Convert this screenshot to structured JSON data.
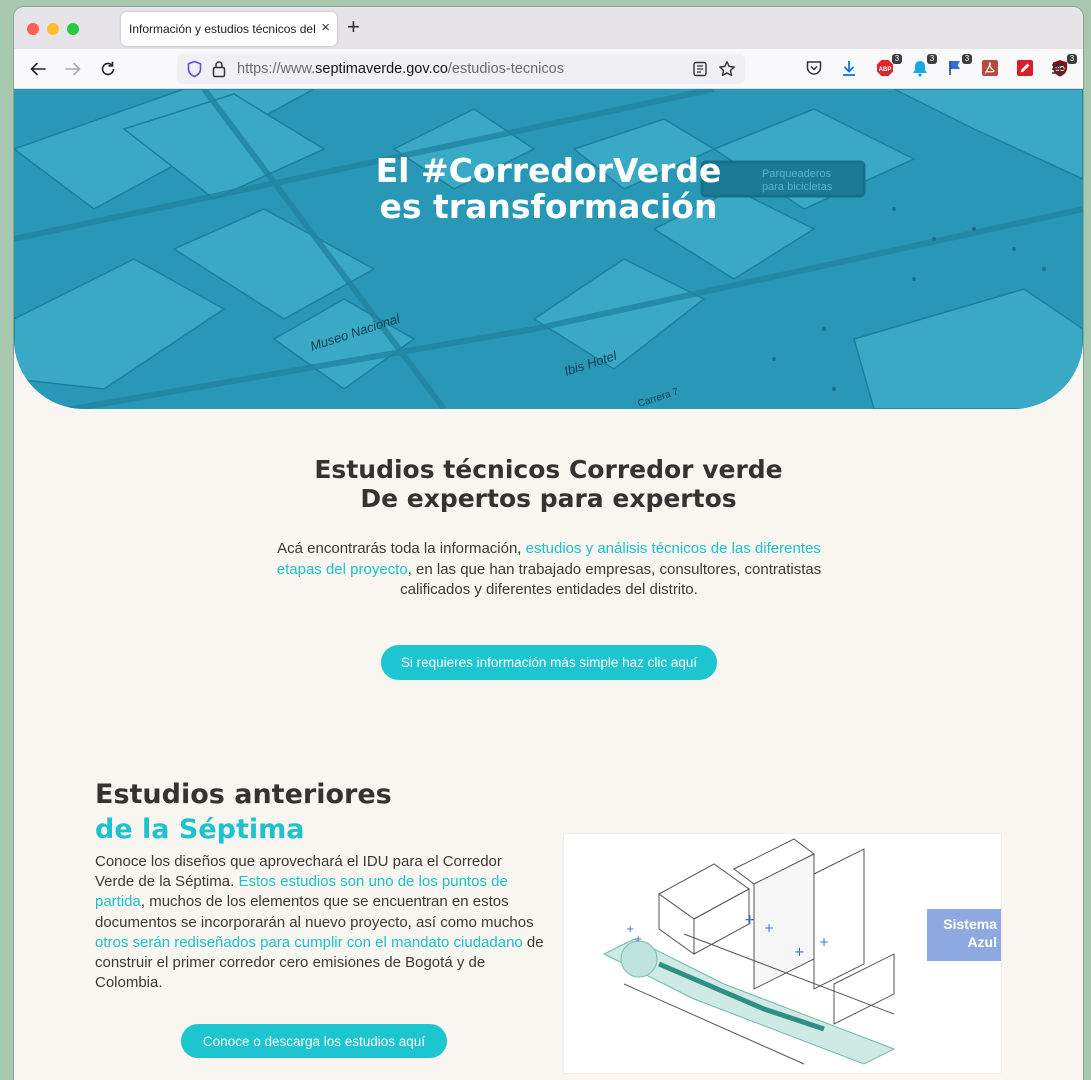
{
  "browser": {
    "tab_title": "Información y estudios técnicos del",
    "tab_close": "×",
    "new_tab": "+",
    "url_prefix": "https://www.",
    "url_domain": "septimaverde.gov.co",
    "url_path": "/estudios-tecnicos",
    "extensions": [
      {
        "name": "adblock",
        "color": "#e0242b",
        "badge": "3"
      },
      {
        "name": "notification",
        "color": "#1ba8e0",
        "badge": "3"
      },
      {
        "name": "flag",
        "color": "#2a6fdb",
        "badge": "3"
      },
      {
        "name": "pdf",
        "color": "#b34b3e",
        "badge": ""
      },
      {
        "name": "pencil",
        "color": "#d91f2a",
        "badge": ""
      },
      {
        "name": "ublock",
        "color": "#8b0d14",
        "badge": "3"
      }
    ]
  },
  "hero": {
    "line1": "El #CorredorVerde",
    "line2": "es transformación",
    "map_labels": [
      "Museo Nacional",
      "Ibis Hotel",
      "Parqueaderos",
      "para bicicletas",
      "Carrera 7"
    ]
  },
  "intro": {
    "title_line1": "Estudios técnicos Corredor verde",
    "title_line2": "De expertos para expertos",
    "text_before": "Acá encontrarás toda la información, ",
    "text_link": "estudios y análisis técnicos de las diferentes etapas del proyecto",
    "text_after": ", en las que han trabajado empresas, consultores, contratistas calificados y diferentes entidades del distrito.",
    "button": "Si requieres información más simple haz clic aquí"
  },
  "previous": {
    "title_line1": "Estudios anteriores",
    "title_line2": "de la Séptima",
    "p1": "Conoce los diseños que aprovechará el IDU para el Corredor Verde de la Séptima. ",
    "p2": "Estos estudios son uno de los puntos de partida",
    "p3": ", muchos de los elementos que se encuentran en estos documentos se incorporarán al nuevo proyecto, así como muchos ",
    "p4": "otros serán rediseñados para cumplir con el mandato ciudadano",
    "p5": " de construir el primer corredor cero emisiones de Bogotá y de Colombia.",
    "button": "Conoce o descarga los estudios aquí",
    "illustration_badge": "Sistema Azul"
  },
  "colors": {
    "accent": "#1cc5cf",
    "hero_bg": "#2796b4",
    "page_bg": "#f9f5f1"
  }
}
